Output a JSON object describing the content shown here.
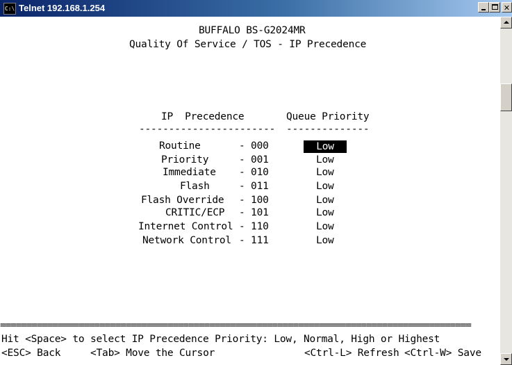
{
  "window": {
    "title": "Telnet 192.168.1.254",
    "icon_label": "C:\\",
    "buttons": [
      "minimize",
      "maximize",
      "close"
    ]
  },
  "screen": {
    "device": "BUFFALO BS-G2024MR",
    "page_title": "Quality Of Service / TOS - IP Precedence",
    "columns": {
      "precedence": "IP  Precedence",
      "priority": "Queue Priority",
      "precedence_rule": "-----------------------",
      "priority_rule": "--------------"
    },
    "rows": [
      {
        "name": "Routine",
        "code": "- 000",
        "priority": "Low",
        "selected": true
      },
      {
        "name": "Priority",
        "code": "- 001",
        "priority": "Low"
      },
      {
        "name": "Immediate",
        "code": "- 010",
        "priority": "Low"
      },
      {
        "name": "Flash",
        "code": "- 011",
        "priority": "Low"
      },
      {
        "name": "Flash Override",
        "code": "- 100",
        "priority": "Low"
      },
      {
        "name": "CRITIC/ECP",
        "code": "- 101",
        "priority": "Low"
      },
      {
        "name": "Internet Control",
        "code": "- 110",
        "priority": "Low"
      },
      {
        "name": "Network Control",
        "code": "- 111",
        "priority": "Low"
      }
    ],
    "separator": "==========================================================================================",
    "help": "Hit <Space> to select IP Precedence Priority: Low, Normal, High or Highest",
    "footer": {
      "esc": "<ESC> Back",
      "tab": "<Tab> Move the Cursor",
      "refresh": "<Ctrl-L> Refresh",
      "save": "<Ctrl-W> Save"
    }
  },
  "colors": {
    "titlebar_start": "#0a246a",
    "titlebar_end": "#a6caf0",
    "selection_bg": "#000000",
    "selection_fg": "#ffffff"
  }
}
